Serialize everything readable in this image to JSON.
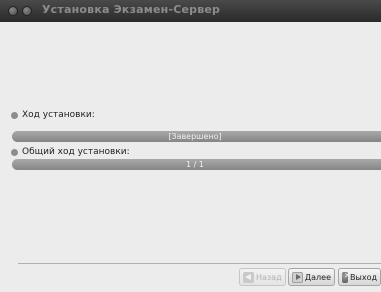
{
  "window": {
    "title": "Установка Экзамен-Сервер"
  },
  "install_progress": {
    "label": "Ход установки:",
    "status_text": "[Завершено]",
    "fraction": 1.0
  },
  "overall_progress": {
    "label": "Общий ход установки:",
    "status_text": "1 / 1",
    "fraction": 1.0
  },
  "buttons": {
    "back": {
      "label": "Назад",
      "icon": "arrow-left-icon",
      "enabled": false
    },
    "next": {
      "label": "Далее",
      "icon": "arrow-right-icon",
      "enabled": true
    },
    "exit": {
      "label": "Выход",
      "icon": "close-circle-icon",
      "enabled": true
    }
  },
  "colors": {
    "titlebar": "#2f2f2f",
    "progress_fill": "#939393",
    "background": "#ececec"
  }
}
